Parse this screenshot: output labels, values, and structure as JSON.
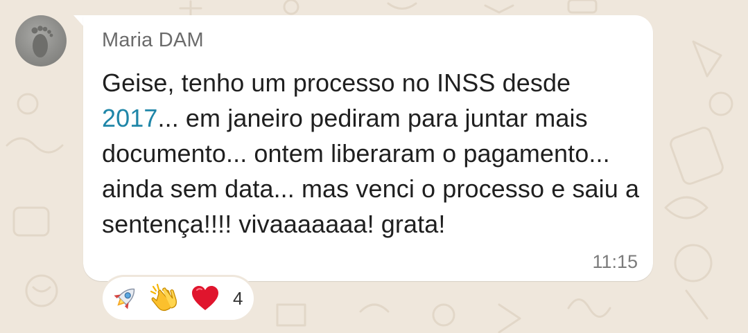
{
  "message": {
    "sender": "Maria DAM",
    "text_before_link": "Geise, tenho um processo no INSS desde ",
    "link_text": "2017",
    "text_after_link": "... em janeiro pediram para juntar mais documento... ontem liberaram o pagamento... ainda sem data... mas venci o processo e saiu a sentença!!!! vivaaaaaaa! grata!",
    "time": "11:15"
  },
  "reactions": {
    "emojis": [
      "rocket-icon",
      "clapping-hands-icon",
      "red-heart-icon"
    ],
    "count": "4"
  },
  "colors": {
    "wallpaper": "#efe7dc",
    "bubble": "#ffffff",
    "link": "#1f86a8",
    "sender": "#6b6b6b"
  }
}
